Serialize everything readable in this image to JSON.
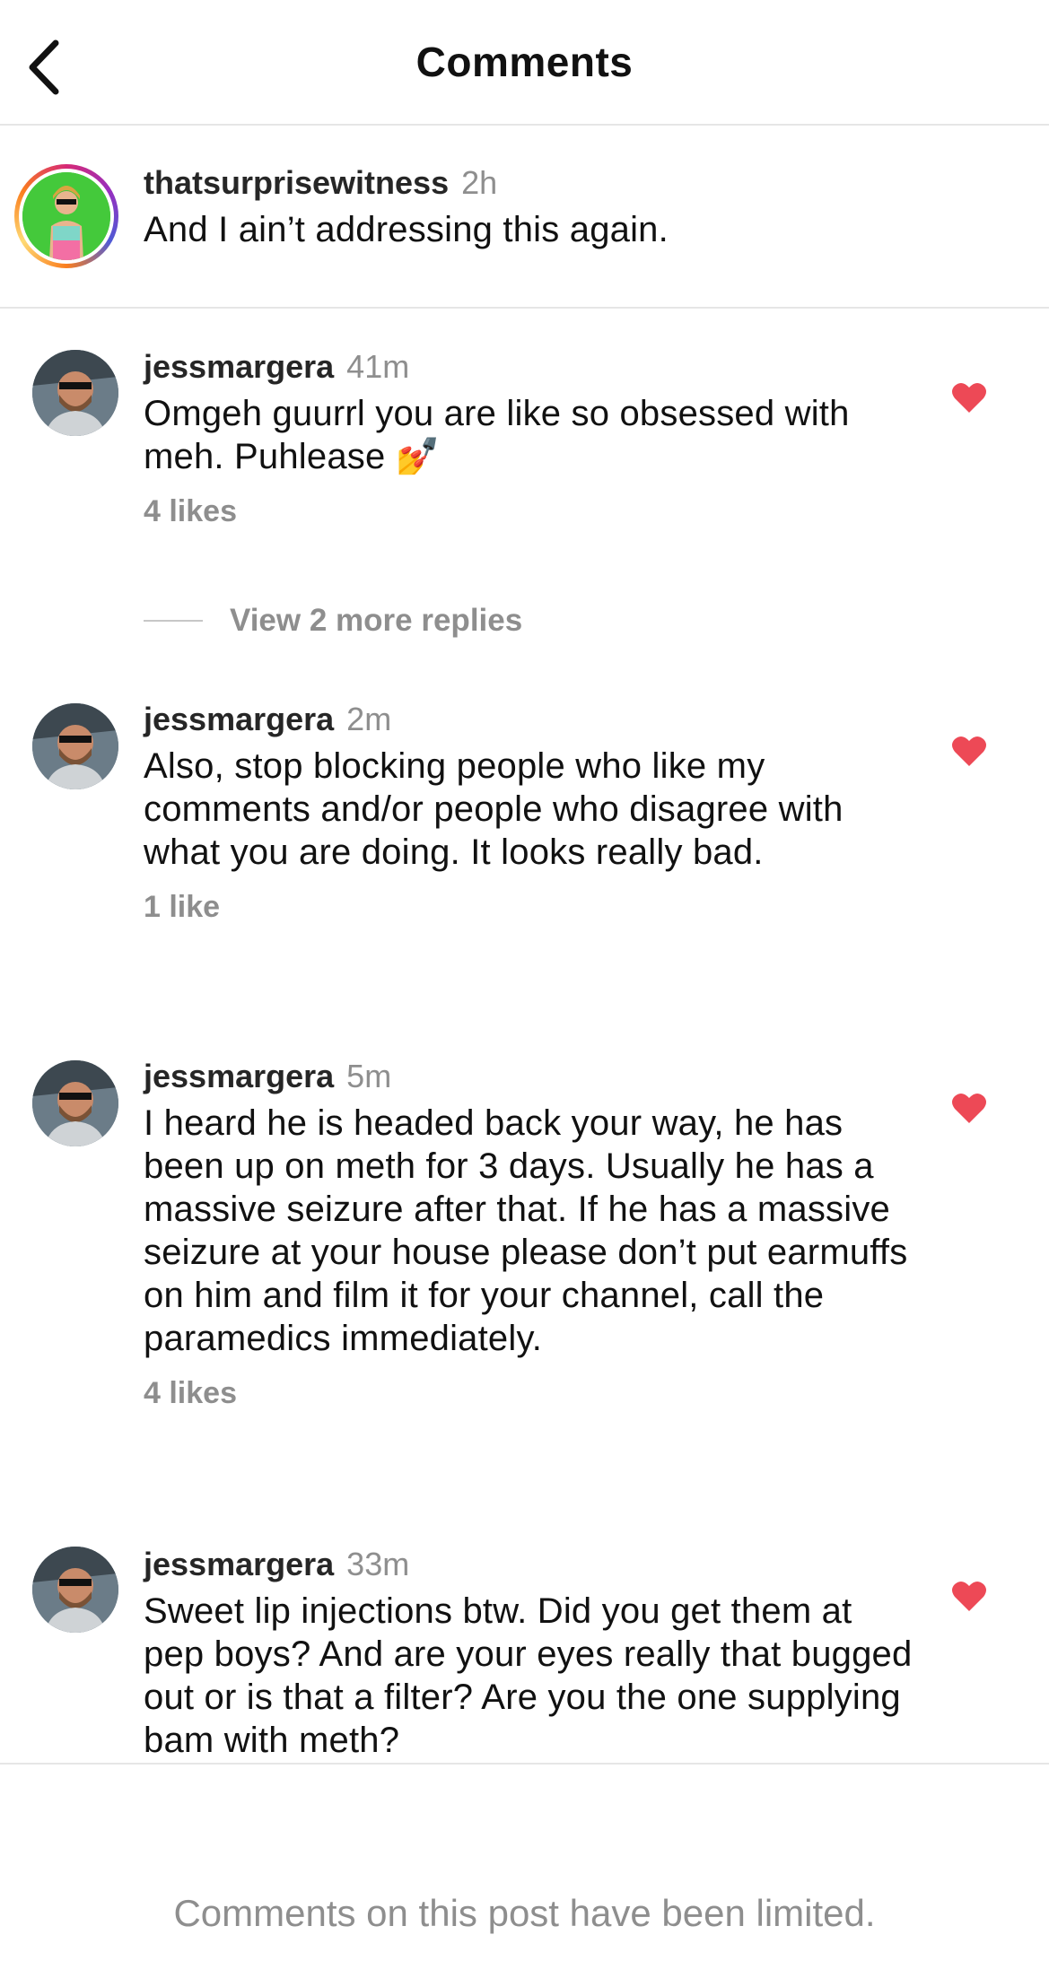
{
  "header": {
    "title": "Comments",
    "back_icon": "chevron-left-icon"
  },
  "caption": {
    "username": "thatsurprisewitness",
    "time": "2h",
    "text": "And I ain’t addressing this again."
  },
  "comments": [
    {
      "username": "jessmargera",
      "time": "41m",
      "text": "Omgeh guurrl you are like so obsessed with meh. Puhlease 💅",
      "likes": "4 likes",
      "liked": true
    },
    {
      "username": "jessmargera",
      "time": "2m",
      "text": "Also, stop blocking people who like my comments and/or people who disagree with what you are doing. It looks really bad.",
      "likes": "1 like",
      "liked": true
    },
    {
      "username": "jessmargera",
      "time": "5m",
      "text": "I heard he is headed back your way, he has been up on meth for 3 days. Usually he has a massive seizure after that. If he has a massive seizure at your house please don’t put earmuffs on him and film it for your channel, call the paramedics immediately.",
      "likes": "4 likes",
      "liked": true
    },
    {
      "username": "jessmargera",
      "time": "33m",
      "text": "Sweet lip injections btw. Did you get them at pep boys? And are your eyes really that bugged out or is that a filter? Are you the one supplying bam with meth?",
      "likes": "",
      "liked": true
    }
  ],
  "replies_toggle": {
    "label": "View 2 more replies"
  },
  "footer": {
    "notice": "Comments on this post have been limited."
  },
  "colors": {
    "heart": "#ed4956",
    "secondary_text": "#8e8e8e",
    "divider": "#e6e6e6"
  }
}
